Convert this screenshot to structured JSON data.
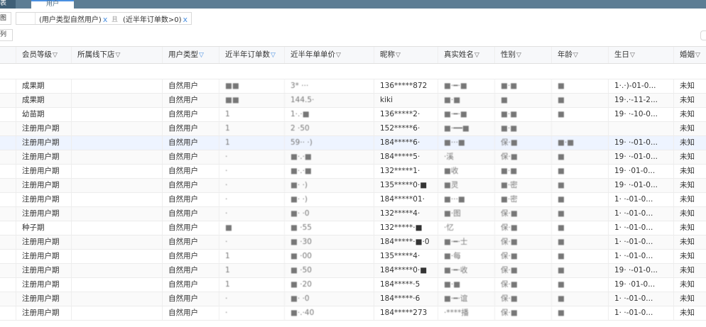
{
  "tabs": {
    "left_label": "表",
    "active_label": "用户"
  },
  "filters": {
    "left_label": "图",
    "chips": [
      {
        "label": "(用户类型自然用户)",
        "close": "x"
      },
      {
        "label": "(近半年订单数>0)",
        "close": "x"
      }
    ],
    "joiner": "且"
  },
  "toolbar": {
    "left_label": "列"
  },
  "columns": [
    {
      "label": "会员等级",
      "active": false
    },
    {
      "label": "所属线下店",
      "active": false
    },
    {
      "label": "用户类型",
      "active": true
    },
    {
      "label": "近半年订单数",
      "active": true
    },
    {
      "label": "近半年单单价",
      "active": false
    },
    {
      "label": "昵称",
      "active": false
    },
    {
      "label": "真实姓名",
      "active": false
    },
    {
      "label": "性别",
      "active": false
    },
    {
      "label": "年龄",
      "active": false
    },
    {
      "label": "生日",
      "active": false
    },
    {
      "label": "婚姻",
      "active": false
    }
  ],
  "filter_icon": "funnel-icon",
  "rows": [
    [
      "成果期",
      "",
      "自然用户",
      "■■",
      "3* ···",
      "136*****872",
      "■·━·■",
      "■·■",
      "■",
      "1·.·)-01-0...",
      "未知"
    ],
    [
      "成果期",
      "",
      "自然用户",
      "■■",
      "144.5·",
      "kiki",
      "■·■",
      "■",
      "■",
      "19·.·-11-2...",
      "未知"
    ],
    [
      "幼苗期",
      "",
      "自然用户",
      "1",
      "1·.·■",
      "136*****2·",
      "■·━·■",
      "■·■",
      "■",
      "19·  ·-10-0...",
      "未知"
    ],
    [
      "注册用户期",
      "",
      "自然用户",
      "1",
      "2  ·50",
      "152*****6·",
      "■·━━■",
      "■·■",
      "",
      "",
      "未知"
    ],
    [
      "注册用户期",
      "",
      "自然用户",
      "1",
      "59·· ·)",
      "184*****6·",
      "■···■",
      "保·■",
      "■·■",
      "19·  ·-01-0...",
      "未知"
    ],
    [
      "注册用户期",
      "",
      "自然用户",
      "·",
      "■·.·■",
      "184*****5·",
      "·溪",
      "保·■",
      "■",
      "19·  ·-01-0...",
      "未知"
    ],
    [
      "注册用户期",
      "",
      "自然用户",
      "·",
      "■·.·■",
      "132*****1·",
      "■收",
      "■·■",
      "■",
      "19·  ·01-0...",
      "未知"
    ],
    [
      "注册用户期",
      "",
      "自然用户",
      "·",
      "■·  ·)",
      "135*****0·■",
      "■灵",
      "■·密",
      "■",
      "19·  ·-01-0...",
      "未知"
    ],
    [
      "注册用户期",
      "",
      "自然用户",
      "·",
      "■·  ·)",
      "184*****01·",
      "■···■",
      "■·密",
      "■",
      "1·  ·-01-0...",
      "未知"
    ],
    [
      "注册用户期",
      "",
      "自然用户",
      "·",
      "■· ·0",
      "132*****4·",
      "■·图",
      "保·■",
      "■",
      "1·  ·-01-0...",
      "未知"
    ],
    [
      "种子期",
      "",
      "自然用户",
      "■",
      "■ ·55",
      "132*****·■",
      "·忆",
      "保·■",
      "■",
      "1·  ·-01-0...",
      "未知"
    ],
    [
      "注册用户期",
      "",
      "自然用户",
      "·",
      "■  ·30",
      "184*****·■·0",
      "■·━·士",
      "保·■",
      "■",
      "1·  ·-01-0...",
      "未知"
    ],
    [
      "注册用户期",
      "",
      "自然用户",
      "1",
      "■  ·00",
      "135*****4·",
      "■·每",
      "保·■",
      "■",
      "1·  ·-01-0...",
      "未知"
    ],
    [
      "注册用户期",
      "",
      "自然用户",
      "1",
      "■  ·50",
      "184*****0·■",
      "■·━·收",
      "保·■",
      "■",
      "19·  ·-01-0...",
      "未知"
    ],
    [
      "注册用户期",
      "",
      "自然用户",
      "1",
      "■  ·20",
      "184*****·5",
      "■·■",
      "保·■",
      "■",
      "19·  ·01-0...",
      "未知"
    ],
    [
      "注册用户期",
      "",
      "自然用户",
      "·",
      "■·  ·0",
      "184*****·6",
      "■·━·谊",
      "保·■",
      "■",
      "1·  ·-01-0...",
      "未知"
    ],
    [
      "注册用户期",
      "",
      "自然用户",
      "·",
      "■·.·40",
      "184*****273",
      "·****播",
      "保·■",
      "■",
      "1·  ·-01-0...",
      "未知"
    ]
  ]
}
